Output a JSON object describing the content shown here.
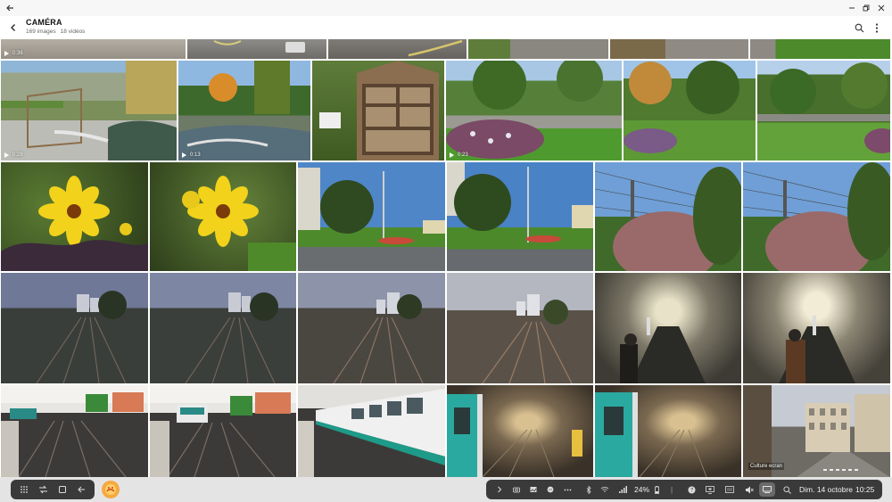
{
  "header": {
    "title": "CAMÉRA",
    "image_count": "169 images",
    "video_count": "18 vidéos"
  },
  "icons": {
    "back": "arrow-left-icon",
    "nav_back": "chevron-left-icon",
    "search": "search-icon",
    "more": "more-vertical-icon",
    "minimize": "minimize-icon",
    "restore": "restore-icon",
    "close": "close-icon"
  },
  "rows": [
    {
      "row": "partial-top",
      "tiles": [
        {
          "kind": "video",
          "duration": "0:36",
          "subject": "gravel path"
        },
        {
          "kind": "image",
          "subject": "pavement markings"
        },
        {
          "kind": "image",
          "subject": "pavement sign"
        },
        {
          "kind": "image",
          "subject": "pavement and grass"
        },
        {
          "kind": "image",
          "subject": "paved path"
        },
        {
          "kind": "image",
          "subject": "grass lawn"
        }
      ]
    },
    {
      "row": "garden",
      "tiles": [
        {
          "kind": "video",
          "duration": "0:28",
          "subject": "garden with pond"
        },
        {
          "kind": "video",
          "duration": "0:13",
          "subject": "pond with tall grass"
        },
        {
          "kind": "image",
          "subject": "insect hotel"
        },
        {
          "kind": "video",
          "duration": "0:23",
          "subject": "park flower bed"
        },
        {
          "kind": "image",
          "subject": "park trees"
        },
        {
          "kind": "image",
          "subject": "park lawn"
        }
      ]
    },
    {
      "row": "flowers",
      "tiles": [
        {
          "kind": "image",
          "subject": "yellow flower"
        },
        {
          "kind": "image",
          "subject": "yellow flowers"
        },
        {
          "kind": "image",
          "subject": "roundabout garden"
        },
        {
          "kind": "image",
          "subject": "roundabout garden"
        },
        {
          "kind": "image",
          "subject": "bushes and power lines"
        },
        {
          "kind": "image",
          "subject": "bushes and power lines"
        }
      ]
    },
    {
      "row": "railway",
      "tiles": [
        {
          "kind": "image",
          "subject": "railway tracks at dusk"
        },
        {
          "kind": "image",
          "subject": "railway tracks at dusk"
        },
        {
          "kind": "image",
          "subject": "railway tracks at dusk"
        },
        {
          "kind": "image",
          "subject": "railway tracks at dusk"
        },
        {
          "kind": "image",
          "subject": "metro escalator tunnel"
        },
        {
          "kind": "image",
          "subject": "metro escalator tunnel"
        }
      ]
    },
    {
      "row": "metro",
      "tiles": [
        {
          "kind": "image",
          "subject": "metro station"
        },
        {
          "kind": "image",
          "subject": "metro station with train"
        },
        {
          "kind": "image",
          "subject": "metro train"
        },
        {
          "kind": "image",
          "subject": "metro train in tunnel"
        },
        {
          "kind": "image",
          "subject": "metro train in tunnel"
        },
        {
          "kind": "image",
          "subject": "Paris street",
          "caption": "Culture ecran"
        }
      ]
    }
  ],
  "taskbar": {
    "left_icons": [
      "apps-icon",
      "recent-icon",
      "overview-icon",
      "back-icon"
    ],
    "app_icon": "gallery-app-icon",
    "tray_icons": [
      "chevron-right-icon",
      "camera-icon",
      "gallery-icon",
      "chat-icon",
      "more-horizontal-icon",
      "bluetooth-icon",
      "wifi-icon",
      "signal-icon"
    ],
    "battery": "24%",
    "tray_icons_right": [
      "help-icon",
      "screen-icon",
      "keyboard-icon",
      "mute-icon",
      "dex-icon",
      "search-icon"
    ],
    "date": "Dim. 14 octobre",
    "time": "10:25"
  }
}
